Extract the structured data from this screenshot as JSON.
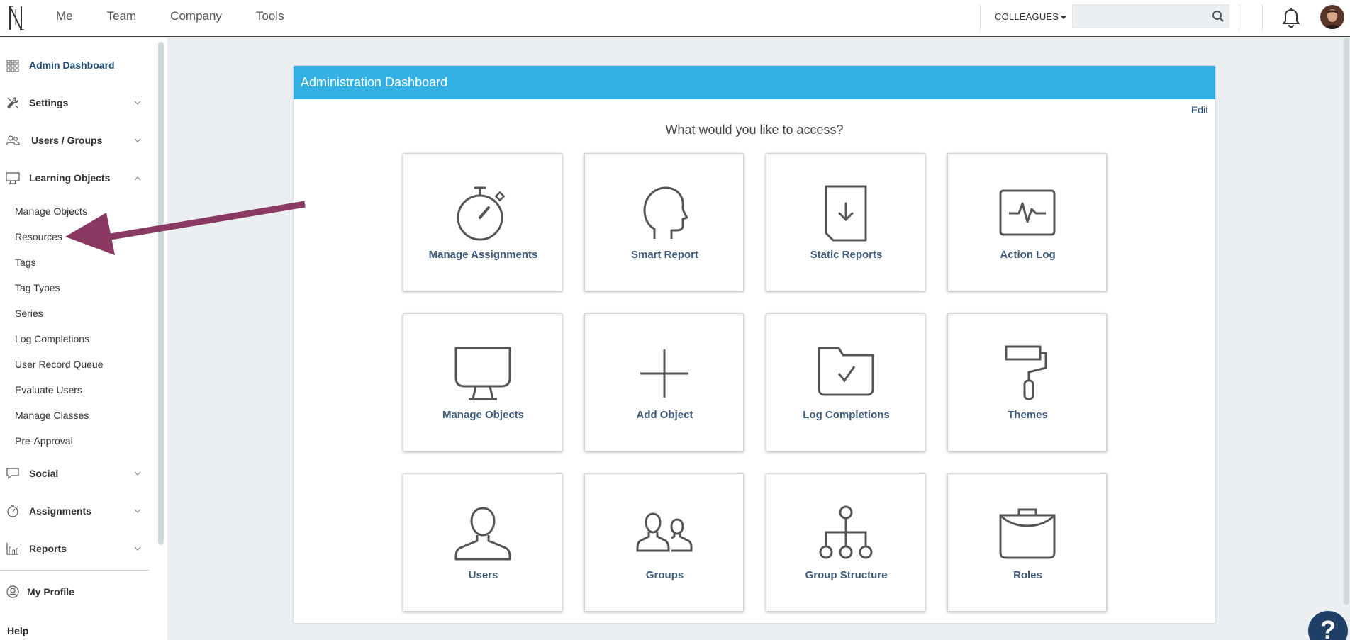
{
  "topbar": {
    "nav": [
      "Me",
      "Team",
      "Company",
      "Tools"
    ],
    "colleagues_label": "COLLEAGUES",
    "search_placeholder": ""
  },
  "sidebar": {
    "items": [
      {
        "label": "Admin Dashboard",
        "icon": "grid-icon"
      },
      {
        "label": "Settings",
        "icon": "tools-icon"
      },
      {
        "label": "Users / Groups",
        "icon": "users-icon"
      },
      {
        "label": "Learning Objects",
        "icon": "monitor-icon"
      }
    ],
    "sub_items": [
      "Manage Objects",
      "Resources",
      "Tags",
      "Tag Types",
      "Series",
      "Log Completions",
      "User Record Queue",
      "Evaluate Users",
      "Manage Classes",
      "Pre-Approval"
    ],
    "items_after": [
      {
        "label": "Social",
        "icon": "chat-icon"
      },
      {
        "label": "Assignments",
        "icon": "stopwatch-icon"
      },
      {
        "label": "Reports",
        "icon": "bar-chart-icon"
      }
    ],
    "profile": "My Profile",
    "help": "Help"
  },
  "main": {
    "header": "Administration Dashboard",
    "edit": "Edit",
    "prompt": "What would you like to access?",
    "tiles": [
      {
        "label": "Manage Assignments",
        "icon": "stopwatch-icon"
      },
      {
        "label": "Smart Report",
        "icon": "head-icon"
      },
      {
        "label": "Static Reports",
        "icon": "document-download-icon"
      },
      {
        "label": "Action Log",
        "icon": "pulse-icon"
      },
      {
        "label": "Manage Objects",
        "icon": "monitor-icon"
      },
      {
        "label": "Add Object",
        "icon": "plus-icon"
      },
      {
        "label": "Log Completions",
        "icon": "folder-check-icon"
      },
      {
        "label": "Themes",
        "icon": "paint-roller-icon"
      },
      {
        "label": "Users",
        "icon": "user-icon"
      },
      {
        "label": "Groups",
        "icon": "group-icon"
      },
      {
        "label": "Group Structure",
        "icon": "hierarchy-icon"
      },
      {
        "label": "Roles",
        "icon": "briefcase-icon"
      }
    ]
  },
  "help_bubble": "?",
  "colors": {
    "header": "#33b0e3",
    "tile_label": "#3d5a7c",
    "active_nav": "#1f4e79",
    "arrow": "#8a3a62"
  }
}
